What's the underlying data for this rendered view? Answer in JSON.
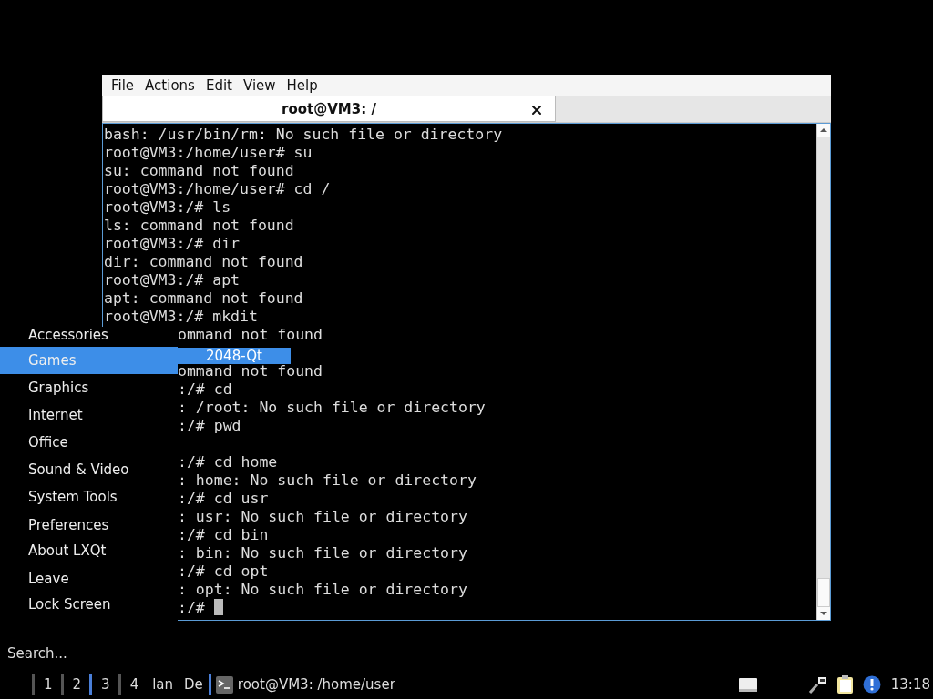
{
  "terminal_window": {
    "menu_bar": [
      "File",
      "Actions",
      "Edit",
      "View",
      "Help"
    ],
    "tabs": [
      {
        "title": "root@VM3: /",
        "selected": true
      }
    ],
    "lines": [
      "bash: /usr/bin/rm: No such file or directory",
      "root@VM3:/home/user# su",
      "su: command not found",
      "root@VM3:/home/user# cd /",
      "root@VM3:/# ls",
      "ls: command not found",
      "root@VM3:/# dir",
      "dir: command not found",
      "root@VM3:/# apt",
      "apt: command not found",
      "root@VM3:/# mkdit"
    ],
    "lines_beside_menu": [
      {
        "kind": "text",
        "text": "ommand not found"
      },
      {
        "kind": "gap"
      },
      {
        "kind": "text",
        "text": "ommand not found"
      },
      {
        "kind": "text",
        "text": ":/# cd"
      },
      {
        "kind": "text",
        "text": ": /root: No such file or directory"
      },
      {
        "kind": "text",
        "text": ":/# pwd"
      },
      {
        "kind": "gap"
      },
      {
        "kind": "text",
        "text": ":/# cd home"
      },
      {
        "kind": "text",
        "text": ": home: No such file or directory"
      },
      {
        "kind": "text",
        "text": ":/# cd usr"
      },
      {
        "kind": "text",
        "text": ": usr: No such file or directory"
      },
      {
        "kind": "text",
        "text": ":/# cd bin"
      },
      {
        "kind": "text",
        "text": ": bin: No such file or directory"
      },
      {
        "kind": "text",
        "text": ":/# cd opt"
      },
      {
        "kind": "text",
        "text": ": opt: No such file or directory"
      }
    ],
    "prompt": ":/#"
  },
  "app_menu": {
    "sections": [
      {
        "items": [
          {
            "label": "Accessories",
            "selected": false
          },
          {
            "label": "Games",
            "selected": true
          },
          {
            "label": "Graphics",
            "selected": false
          },
          {
            "label": "Internet",
            "selected": false
          },
          {
            "label": "Office",
            "selected": false
          },
          {
            "label": "Sound & Video",
            "selected": false
          },
          {
            "label": "System Tools",
            "selected": false
          }
        ]
      },
      {
        "items": [
          {
            "label": "Preferences",
            "selected": false
          },
          {
            "label": "About LXQt",
            "selected": false
          }
        ]
      },
      {
        "items": [
          {
            "label": "Leave",
            "selected": false
          },
          {
            "label": "Lock Screen",
            "selected": false
          }
        ]
      }
    ],
    "submenu": [
      {
        "label": "2048-Qt",
        "selected": true
      }
    ],
    "search": {
      "placeholder": "Search..."
    }
  },
  "taskbar": {
    "desktops": [
      {
        "label": "1",
        "selected": false
      },
      {
        "label": "2",
        "selected": false
      },
      {
        "label": "3",
        "selected": true
      },
      {
        "label": "4",
        "selected": false
      }
    ],
    "cut_labels": [
      "lan",
      "De"
    ],
    "tasks": [
      {
        "title": "root@VM3: /home/user",
        "selected": true
      }
    ],
    "clock": "13:18"
  }
}
